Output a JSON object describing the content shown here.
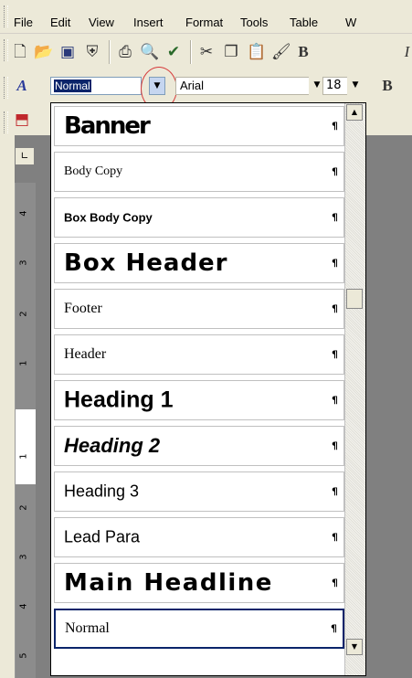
{
  "menubar": {
    "items": [
      "File",
      "Edit",
      "View",
      "Insert",
      "Format",
      "Tools",
      "Table",
      "W"
    ]
  },
  "toolbar": {
    "icons": [
      "new-document",
      "open-folder",
      "save-disk",
      "permission",
      "print",
      "print-preview",
      "spelling",
      "cut",
      "copy",
      "paste",
      "format-painter",
      "bold",
      "italic-partial"
    ]
  },
  "formatting": {
    "style_value": "Normal",
    "font_value": "Arial",
    "size_value": "18",
    "bold_label": "B"
  },
  "style_list": {
    "items": [
      {
        "label": "Banner",
        "mark": "¶"
      },
      {
        "label": "Body Copy",
        "mark": "¶"
      },
      {
        "label": "Box Body Copy",
        "mark": "¶"
      },
      {
        "label": "Box Header",
        "mark": "¶"
      },
      {
        "label": "Footer",
        "mark": "¶"
      },
      {
        "label": "Header",
        "mark": "¶"
      },
      {
        "label": "Heading 1",
        "mark": "¶"
      },
      {
        "label": "Heading 2",
        "mark": "¶"
      },
      {
        "label": "Heading 3",
        "mark": "¶"
      },
      {
        "label": "Lead Para",
        "mark": "¶"
      },
      {
        "label": "Main Headline",
        "mark": "¶"
      },
      {
        "label": "Normal",
        "mark": "¶"
      }
    ],
    "selected": "Normal"
  },
  "ruler": {
    "numbers": [
      "4",
      "3",
      "2",
      "1",
      "1",
      "2",
      "3",
      "4",
      "5"
    ]
  },
  "colors": {
    "highlight": "#0a246a",
    "annotation_circle": "#d63a3a",
    "toolbar_bg": "#ece9d8"
  }
}
